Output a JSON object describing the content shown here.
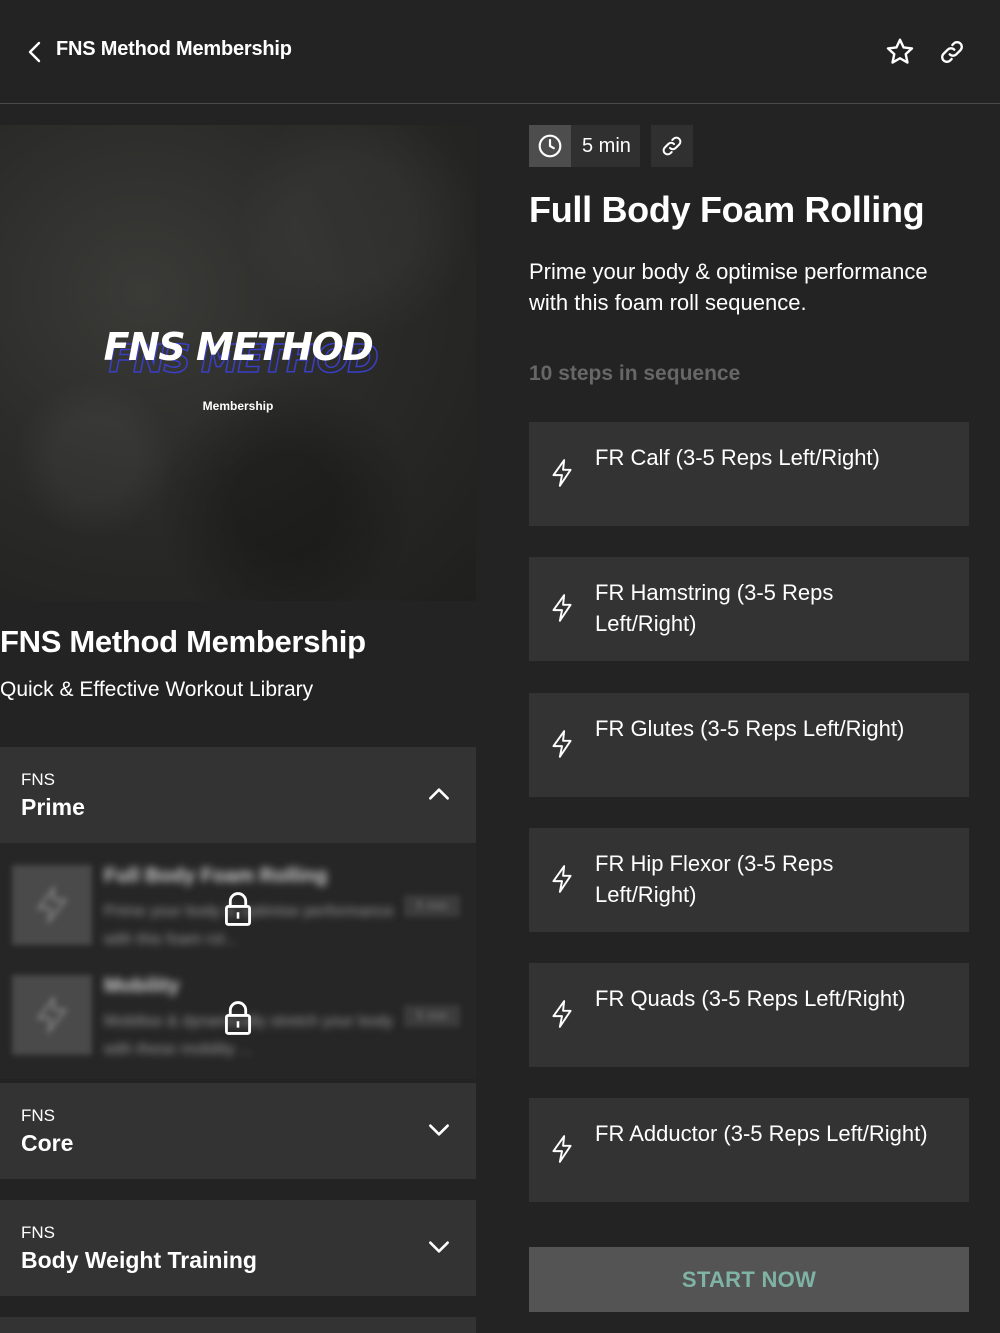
{
  "header": {
    "title": "FNS Method Membership",
    "back_icon": "chevron-left-icon",
    "favorite_icon": "star-icon",
    "share_icon": "link-icon"
  },
  "program": {
    "hero_logo_text": "FNS METHOD",
    "hero_subtitle": "Membership",
    "title": "FNS Method Membership",
    "subtitle": "Quick & Effective Workout Library"
  },
  "sections": [
    {
      "category": "FNS",
      "name": "Prime",
      "expanded": true,
      "workouts": [
        {
          "title": "Full Body Foam Rolling",
          "description": "Prime your body & optimise performance with this foam rol...",
          "duration": "5 min",
          "locked": true
        },
        {
          "title": "Mobility",
          "description": "Mobilise & dynamically stretch your body with these mobility ...",
          "duration": "5 min",
          "locked": true
        }
      ]
    },
    {
      "category": "FNS",
      "name": "Core",
      "expanded": false
    },
    {
      "category": "FNS",
      "name": "Body Weight Training",
      "expanded": false
    }
  ],
  "workout": {
    "duration": "5 min",
    "title": "Full Body Foam Rolling",
    "description": "Prime your body & optimise performance with this foam roll sequence.",
    "steps_count_label": "10 steps in sequence",
    "steps": [
      "FR Calf (3-5 Reps Left/Right)",
      "FR Hamstring (3-5 Reps Left/Right)",
      "FR Glutes (3-5 Reps Left/Right)",
      "FR Hip Flexor (3-5 Reps Left/Right)",
      "FR Quads (3-5 Reps Left/Right)",
      "FR Adductor (3-5 Reps Left/Right)"
    ],
    "start_label": "START NOW"
  },
  "colors": {
    "background": "#232323",
    "card": "#333333",
    "start_text": "#7fb3a3",
    "start_bg": "#545454",
    "muted": "#676767",
    "logo_outline": "#3a3fc8"
  }
}
